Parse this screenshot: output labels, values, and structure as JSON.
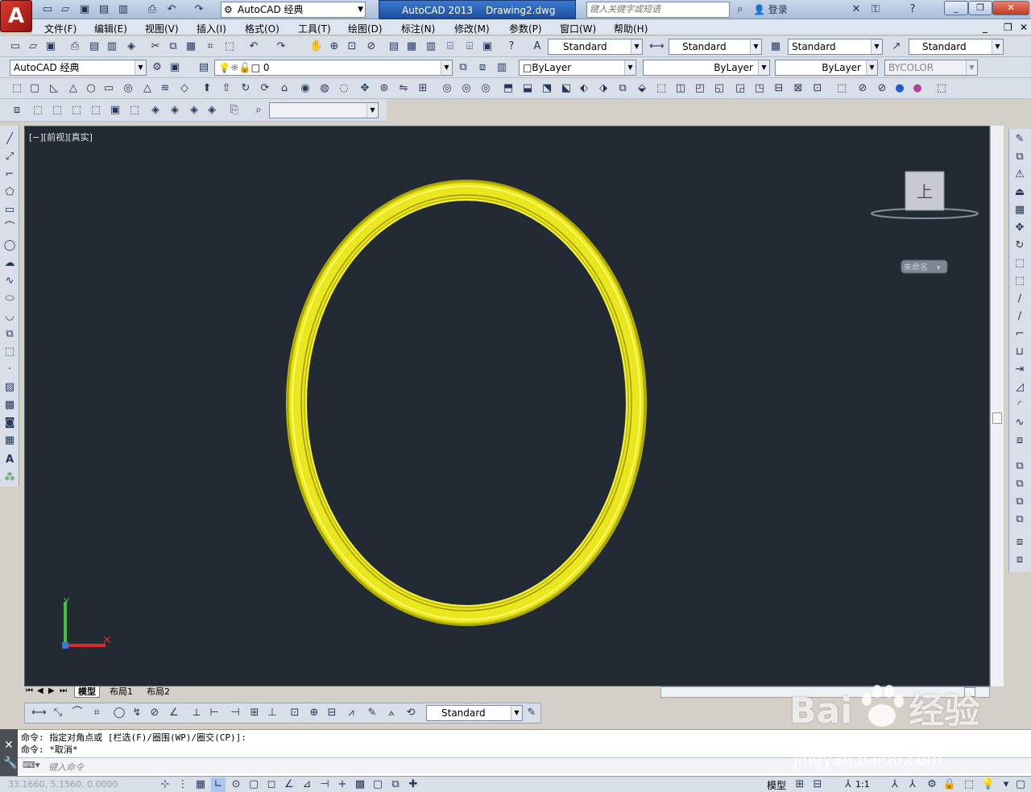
{
  "title_bar": {
    "app_logo": "A",
    "workspace": "AutoCAD 经典",
    "app_name": "AutoCAD 2013",
    "doc_name": "Drawing2.dwg",
    "search_placeholder": "键入关键字或短语",
    "login": "登录",
    "window_controls": [
      "minimize-icon",
      "restore-icon",
      "close-icon"
    ]
  },
  "menubar": {
    "items": [
      "文件(F)",
      "编辑(E)",
      "视图(V)",
      "插入(I)",
      "格式(O)",
      "工具(T)",
      "绘图(D)",
      "标注(N)",
      "修改(M)",
      "参数(P)",
      "窗口(W)",
      "帮助(H)"
    ]
  },
  "styles_toolbar": {
    "text_style": "Standard",
    "dim_style": "Standard",
    "table_style": "Standard",
    "mleader_style": "Standard"
  },
  "workspace_toolbar": {
    "workspace": "AutoCAD 经典",
    "layer": "0",
    "color": "ByLayer",
    "linetype": "ByLayer",
    "lineweight": "ByLayer",
    "plot_style": "BYCOLOR"
  },
  "viewport": {
    "label": "[−][前视][真实]",
    "viewcube_face": "上",
    "ucs_name": "未命名",
    "ring_color": "#e3e000",
    "background": "#222a33"
  },
  "layout_tabs": [
    "模型",
    "布局1",
    "布局2"
  ],
  "dim_toolbar": {
    "dim_style": "Standard"
  },
  "command": {
    "line1": "命令: 指定对角点或 [栏选(F)/圈围(WP)/圈交(CP)]:",
    "line2": "命令: *取消*",
    "input_placeholder": "键入命令"
  },
  "status": {
    "coords": "33.1660,  5.1560,  0.0000",
    "model_label": "模型",
    "annotation_scale": "1:1"
  },
  "watermark": {
    "main": "Bai",
    "cn": "经验",
    "url": "jingyan.baidu.com"
  }
}
